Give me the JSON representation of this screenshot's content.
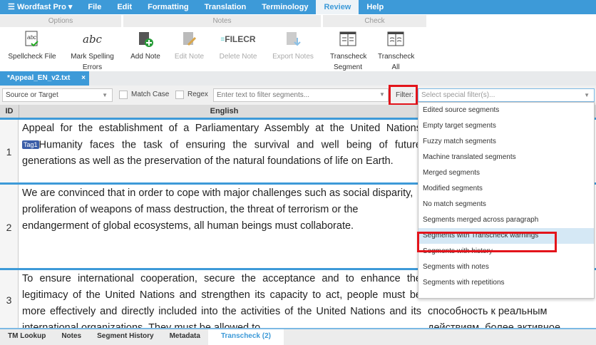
{
  "menu": {
    "app": "Wordfast Pro",
    "items": [
      "File",
      "Edit",
      "Formatting",
      "Translation",
      "Terminology",
      "Review",
      "Help"
    ],
    "active": "Review"
  },
  "ribbon": {
    "groups": [
      "Options",
      "Notes",
      "Check"
    ],
    "buttons": [
      {
        "label": "Spellcheck File",
        "enabled": true
      },
      {
        "label": "Mark Spelling Errors",
        "enabled": true
      },
      {
        "label": "Add Note",
        "enabled": true
      },
      {
        "label": "Edit Note",
        "enabled": false
      },
      {
        "label": "Delete Note",
        "enabled": false
      },
      {
        "label": "Export Notes",
        "enabled": false
      },
      {
        "label": "Transcheck Segment",
        "enabled": true
      },
      {
        "label": "Transcheck All",
        "enabled": true
      }
    ]
  },
  "watermark": "FILECR",
  "doc_tab": {
    "label": "*Appeal_EN_v2.txt",
    "close": "×"
  },
  "filter": {
    "scope": "Source or Target",
    "match_case": "Match Case",
    "regex": "Regex",
    "text_placeholder": "Enter text to filter segments...",
    "filter_label": "Filter:",
    "special_placeholder": "Select special filter(s)..."
  },
  "table": {
    "col_id": "ID",
    "col_source": "English"
  },
  "segments": [
    {
      "id": "1",
      "pre": "Appeal for the establishment of a Parliamentary Assembly at the United Nations",
      "tag": "Tag1",
      "post": "Humanity faces the task of ensuring the survival and well being of future generations as well as the preservation of the natural foundations of life on Earth."
    },
    {
      "id": "2",
      "text": "We are convinced that in order to cope with major challenges such as social disparity, proliferation of weapons of mass destruction, the threat of terrorism or the endangerment of global ecosystems, all human beings must collaborate."
    },
    {
      "id": "3",
      "text": "To ensure international cooperation, secure the acceptance and to enhance the legitimacy of the United Nations and strengthen its capacity to act, people must be more effectively and directly included into the activities of the United Nations and its international organizations. They must be allowed to",
      "target": "способность к реальным действиям, более активное участие в работе"
    }
  ],
  "dropdown": {
    "options": [
      "Edited source segments",
      "Empty target segments",
      "Fuzzy match segments",
      "Machine translated segments",
      "Merged segments",
      "Modified segments",
      "No match segments",
      "Segments merged across paragraph",
      "Segments with Transcheck warnings",
      "Segments with history",
      "Segments with notes",
      "Segments with repetitions"
    ],
    "highlighted": "Segments with Transcheck warnings"
  },
  "bottom_tabs": [
    "TM Lookup",
    "Notes",
    "Segment History",
    "Metadata",
    "Transcheck (2)"
  ],
  "bottom_active": "Transcheck (2)"
}
